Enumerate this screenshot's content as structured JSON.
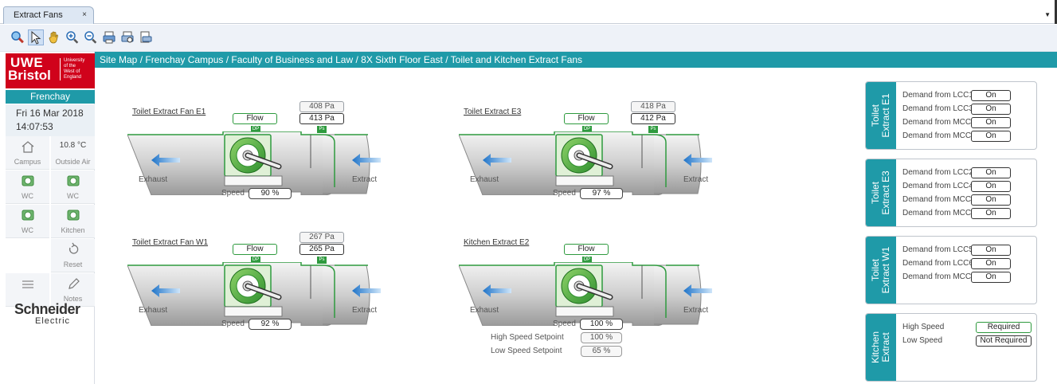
{
  "tab": {
    "label": "Extract Fans",
    "close": "×",
    "dropdown": "▼"
  },
  "toolbar": {
    "icons": [
      "find-icon",
      "pointer-icon",
      "pan-hand-icon",
      "zoom-in-icon",
      "zoom-out-icon",
      "print-icon",
      "print-preview-icon",
      "page-setup-icon"
    ]
  },
  "sidebar": {
    "logo": {
      "line1": "UWE",
      "line2": "Bristol",
      "uni_lines": [
        "University",
        "of the",
        "West of",
        "England"
      ]
    },
    "site": "Frenchay",
    "date": "Fri 16 Mar 2018",
    "time": "14:07:53",
    "campus_label": "Campus",
    "outside_temp": "10.8 °C",
    "outside_label": "Outside Air",
    "wc1": "WC",
    "wc2": "WC",
    "wc3": "WC",
    "kitchen": "Kitchen",
    "reset": "Reset",
    "notes": "Notes",
    "schneider1": "Schneider",
    "schneider2": "Electric"
  },
  "breadcrumb": "Site Map / Frenchay Campus / Faculty of Business and Law / 8X Sixth Floor East / Toilet and Kitchen Extract Fans",
  "fans": [
    {
      "title": "Toilet Extract Fan E1",
      "setpoint": "408 Pa",
      "pressure": "413 Pa",
      "flow": "Flow",
      "dp": "DP",
      "ps": "Ps",
      "speed_label": "Speed",
      "speed": "90 %",
      "exhaust": "Exhaust",
      "extract": "Extract"
    },
    {
      "title": "Toilet Extract E3",
      "setpoint": "418 Pa",
      "pressure": "412 Pa",
      "flow": "Flow",
      "dp": "DP",
      "ps": "Ps",
      "speed_label": "Speed",
      "speed": "97 %",
      "exhaust": "Exhaust",
      "extract": "Extract"
    },
    {
      "title": "Toilet Extract Fan W1",
      "setpoint": "267 Pa",
      "pressure": "265 Pa",
      "flow": "Flow",
      "dp": "DP",
      "ps": "Ps",
      "speed_label": "Speed",
      "speed": "92 %",
      "exhaust": "Exhaust",
      "extract": "Extract"
    },
    {
      "title": "Kitchen Extract E2",
      "flow": "Flow",
      "dp": "DP",
      "speed_label": "Speed",
      "speed": "100 %",
      "exhaust": "Exhaust",
      "extract": "Extract",
      "high_label": "High Speed Setpoint",
      "high": "100 %",
      "low_label": "Low Speed Setpoint",
      "low": "65 %"
    }
  ],
  "panels": [
    {
      "title1": "Toilet",
      "title2": "Extract E1",
      "rows": [
        {
          "label": "Demand from LCC1",
          "value": "On"
        },
        {
          "label": "Demand from LCC3",
          "value": "On"
        },
        {
          "label": "Demand from MCC4",
          "value": "On"
        },
        {
          "label": "Demand from MCC5",
          "value": "On"
        }
      ]
    },
    {
      "title1": "Toilet",
      "title2": "Extract E3",
      "rows": [
        {
          "label": "Demand from LCC2",
          "value": "On"
        },
        {
          "label": "Demand from LCC4",
          "value": "On"
        },
        {
          "label": "Demand from MCC4",
          "value": "On"
        },
        {
          "label": "Demand from MCC5",
          "value": "On"
        }
      ]
    },
    {
      "title1": "Toilet",
      "title2": "Extract W1",
      "rows": [
        {
          "label": "Demand from LCC5",
          "value": "On"
        },
        {
          "label": "Demand from LCC6",
          "value": "On"
        },
        {
          "label": "Demand from MCC5",
          "value": "On"
        }
      ]
    },
    {
      "title1": "Kitchen",
      "title2": "Extract",
      "rows": [
        {
          "label": "High Speed",
          "value": "Required"
        },
        {
          "label": "Low Speed",
          "value": "Not Required"
        }
      ]
    }
  ],
  "colors": {
    "teal": "#1f9aa8",
    "green": "#2e9a3e",
    "red": "#d0021b",
    "arrow": "#4a9fe0"
  }
}
